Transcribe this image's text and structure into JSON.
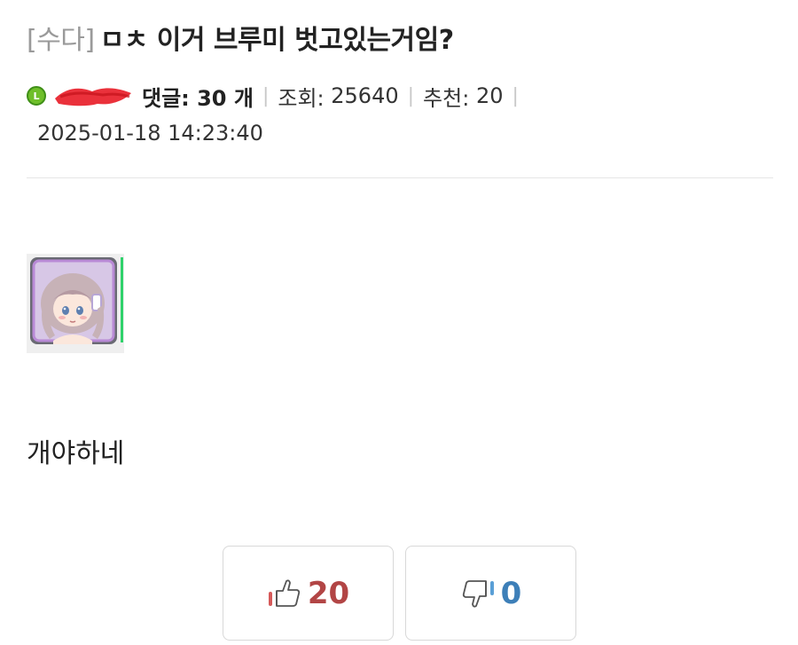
{
  "post": {
    "category": "[수다]",
    "title": "ㅁㅊ 이거 브루미 벗고있는거임?",
    "author": {
      "level_badge": "L",
      "level_icon": "level-badge-icon",
      "name_redacted": true
    },
    "meta": {
      "comments_label": "댓글: 30 개",
      "views_label": "조회:",
      "views_value": "25640",
      "recommends_label": "추천:",
      "recommends_value": "20",
      "date": "2025-01-18 14:23:40"
    },
    "image": {
      "icon": "character-avatar-image"
    },
    "body": "개야하네"
  },
  "votes": {
    "up": {
      "count": "20",
      "icon": "thumbs-up-icon",
      "color": "#b24545"
    },
    "down": {
      "count": "0",
      "icon": "thumbs-down-icon",
      "color": "#3d7fb8"
    }
  },
  "colors": {
    "category": "#9a9a9a",
    "divider": "#e6e6e6",
    "redaction": "#e8202a",
    "level_badge": "#6fbf2a"
  }
}
